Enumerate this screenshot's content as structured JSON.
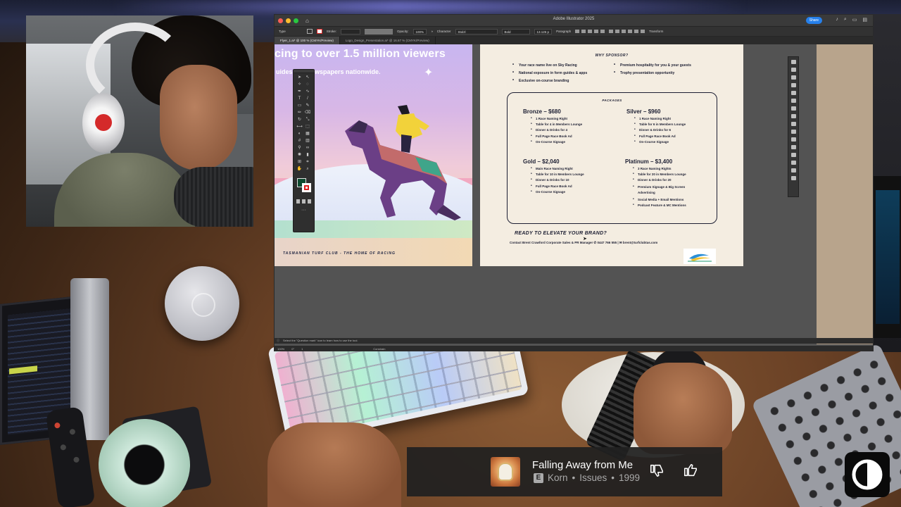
{
  "illustrator": {
    "home_icon": "home-icon",
    "window_title": "Adobe Illustrator 2025",
    "share_label": "Share",
    "control_bar": {
      "mode": "Type",
      "stroke_label": "Stroke:",
      "opacity_label": "Opacity:",
      "opacity_value": "100%",
      "character_label": "Character",
      "font_family": "Stolzl",
      "font_style": "Bold",
      "font_size": "13.125 p",
      "paragraph_label": "Paragraph",
      "transform_label": "Transform"
    },
    "tabs": [
      {
        "label": "Flyer_1.ai* @ 100 % (CMYK/Preview)",
        "active": true
      },
      {
        "label": "Logo_Design_Presentation.ai* @ 16.67 % (CMYK/Preview)",
        "active": false
      }
    ],
    "status_hint": "Select the \"Question mark\" icon to learn how to use the tool.",
    "status_zoom": "100%",
    "status_rotation": "0°",
    "status_artboard": "1",
    "status_mode": "Constrain"
  },
  "flyer": {
    "headline": "cing to over 1.5 million viewers",
    "subline": "uides    and newspapers nationwide.",
    "footer": "TASMANIAN TURF CLUB - THE HOME OF RACING"
  },
  "sponsor": {
    "why_title": "WHY SPONSOR?",
    "why_left": [
      "Your race name live on Sky Racing",
      "National exposure in form guides & apps",
      "Exclusive on-course branding"
    ],
    "why_right": [
      "Premium hospitality for you & your guests",
      "Trophy presentation opportunity"
    ],
    "packages_title": "PACKAGES",
    "packages": [
      {
        "name": "Bronze – $680",
        "items": [
          "1 Race Naming Right",
          "Table for 4 in Members Lounge",
          "Dinner & Drinks for 4",
          "Full Page Race Book Ad",
          "On-Course Signage"
        ]
      },
      {
        "name": "Silver – $960",
        "items": [
          "1 Race Naming Right",
          "Table for 6 in Members Lounge",
          "Dinner & Drinks for 6",
          "Full Page Race Book Ad",
          "On-Course Signage"
        ]
      },
      {
        "name": "Gold – $2,040",
        "items": [
          "Main Race Naming Right",
          "Table for 10 in Members Lounge",
          "Dinner & Drinks for 10",
          "Full Page Race Book Ad",
          "On-Course Signage"
        ]
      },
      {
        "name": "Platinum – $3,400",
        "items": [
          "3 Race Naming Rights",
          "Table for 20 in Members Lounge",
          "Dinner & Drinks for 20",
          "Premium Signage & Big Screen Advertising",
          "Social Media + Email Mentions",
          "Podcast Feature & MC Mentions"
        ]
      }
    ],
    "cta": "READY TO ELEVATE YOUR BRAND?",
    "contact": "Contact Brent Crawford Corporate Sales & PR Manager ✆ 0447 766 555 | ✉ brent@turfclubtas.com"
  },
  "now_playing": {
    "title": "Falling Away from Me",
    "explicit_badge": "E",
    "artist": "Korn",
    "album": "Issues",
    "year": "1999",
    "separator": "•",
    "dislike_icon": "thumbs-down-icon",
    "like_icon": "thumbs-up-icon"
  },
  "colors": {
    "accent_blue": "#2680eb",
    "flyer_navy": "#1d2340",
    "fill_green": "#0d4a2f",
    "artboard_cream": "#f4ede1"
  }
}
